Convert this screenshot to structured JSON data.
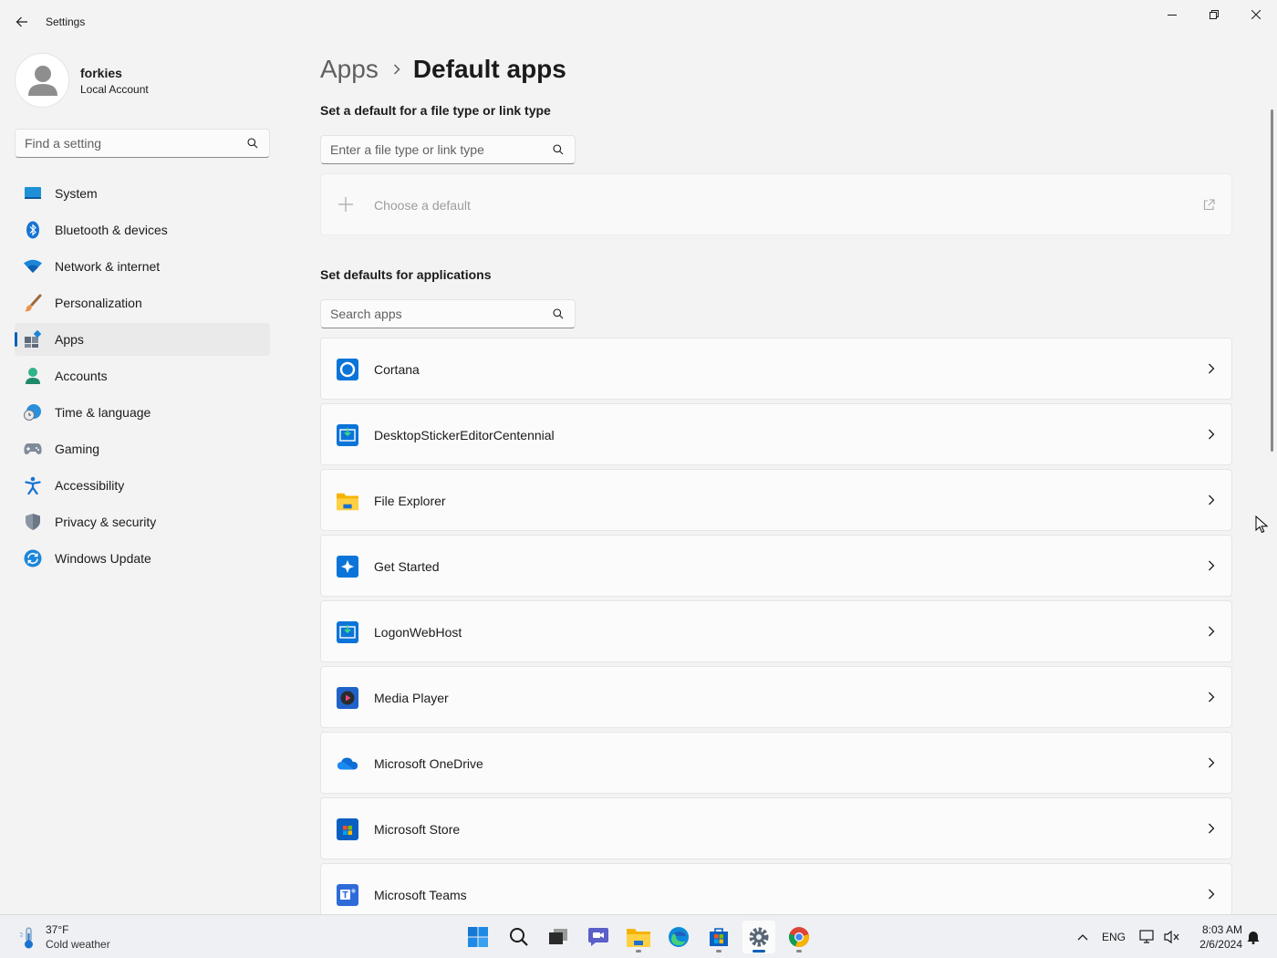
{
  "window": {
    "title": "Settings"
  },
  "profile": {
    "name": "forkies",
    "account_type": "Local Account"
  },
  "sidebar": {
    "search_placeholder": "Find a setting",
    "items": [
      {
        "label": "System",
        "icon": "system-icon"
      },
      {
        "label": "Bluetooth & devices",
        "icon": "bluetooth-icon"
      },
      {
        "label": "Network & internet",
        "icon": "wifi-icon"
      },
      {
        "label": "Personalization",
        "icon": "brush-icon"
      },
      {
        "label": "Apps",
        "icon": "apps-icon",
        "active": true
      },
      {
        "label": "Accounts",
        "icon": "accounts-icon"
      },
      {
        "label": "Time & language",
        "icon": "globe-clock-icon"
      },
      {
        "label": "Gaming",
        "icon": "gamepad-icon"
      },
      {
        "label": "Accessibility",
        "icon": "accessibility-icon"
      },
      {
        "label": "Privacy & security",
        "icon": "shield-icon"
      },
      {
        "label": "Windows Update",
        "icon": "update-icon"
      }
    ]
  },
  "breadcrumb": {
    "parent": "Apps",
    "current": "Default apps"
  },
  "filetype_section": {
    "title": "Set a default for a file type or link type",
    "search_placeholder": "Enter a file type or link type",
    "choose_label": "Choose a default"
  },
  "apps_section": {
    "title": "Set defaults for applications",
    "search_placeholder": "Search apps",
    "apps": [
      {
        "name": "Cortana",
        "icon": "cortana-icon"
      },
      {
        "name": "DesktopStickerEditorCentennial",
        "icon": "sticker-editor-icon"
      },
      {
        "name": "File Explorer",
        "icon": "file-explorer-icon"
      },
      {
        "name": "Get Started",
        "icon": "get-started-icon"
      },
      {
        "name": "LogonWebHost",
        "icon": "logon-webhost-icon"
      },
      {
        "name": "Media Player",
        "icon": "media-player-icon"
      },
      {
        "name": "Microsoft OneDrive",
        "icon": "onedrive-icon"
      },
      {
        "name": "Microsoft Store",
        "icon": "store-icon"
      },
      {
        "name": "Microsoft Teams",
        "icon": "teams-icon"
      }
    ]
  },
  "taskbar": {
    "weather": {
      "temp": "37°F",
      "desc": "Cold weather"
    },
    "apps": [
      "start-icon",
      "search-icon",
      "task-view-icon",
      "chat-icon",
      "file-explorer-icon",
      "edge-icon",
      "store-icon",
      "settings-icon",
      "chrome-icon"
    ],
    "tray": {
      "language": "ENG"
    },
    "clock": {
      "time": "8:03 AM",
      "date": "2/6/2024"
    }
  },
  "colors": {
    "accent": "#005fb8",
    "background": "#f3f3f3",
    "card": "#fbfbfb"
  }
}
